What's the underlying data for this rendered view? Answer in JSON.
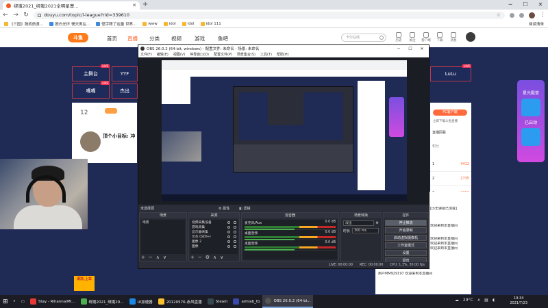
{
  "browser": {
    "tab_title": "绑嵬2021_绑嵬2021全明星寨...",
    "url": "douyu.com/topic/l-league?rid=339610",
    "bookmarks": [
      "《三国》鼓机航食...",
      "脱白光环 慢天男在...",
      "怪宇障了这量 世界...",
      "www",
      "idol",
      "idol",
      "idol 111"
    ],
    "reading_list": "阅读清单"
  },
  "douyu": {
    "logo": "斗鱼",
    "nav": [
      "首页",
      "直播",
      "分类",
      "视频",
      "游戏",
      "鱼吧"
    ],
    "search_placeholder": "卡尔在线",
    "header_icons": [
      "历史",
      "关注",
      "客户端",
      "下载",
      "消息"
    ],
    "live_tiles": [
      "主舞台",
      "YYF",
      "嘴嘴",
      "杰出",
      "LuLu"
    ],
    "live_badge": "LIVE",
    "info_number": "12",
    "streamer_title": "顶个小目标: 冲",
    "pc_client": "PC客户端",
    "pc_sub": "立即下载斗鱼直播",
    "rank_tabs": [
      "直播回看",
      "积分"
    ],
    "ranks": [
      {
        "pos": "1",
        "val": "4412"
      },
      {
        "pos": "2",
        "val": "2735"
      },
      {
        "pos": "3",
        "val": "2050"
      }
    ],
    "chat": [
      "[历史弹幕已加载]",
      "欢迎来到本直播间",
      "欢迎来到本直播间",
      "欢迎来到本直播间",
      "欢迎来到本直播间",
      "用户MM929197 欢迎来到本直播间"
    ],
    "banner_title": "星光殿堂",
    "banner_sub": "已启动",
    "bottom_left": "清凉,上车"
  },
  "obs": {
    "title": "OBS 26.0.2 (64-bit, windows) - 配置文件: 未命名 - 场景: 未命名",
    "menu": [
      "文件(F)",
      "编辑(E)",
      "视图(V)",
      "停靠窗口(D)",
      "配置文件(P)",
      "场景集合(S)",
      "工具(T)",
      "帮助(H)"
    ],
    "source_bar": {
      "label": "未选择源",
      "props": "属性",
      "filters": "滤镜"
    },
    "docks": {
      "scenes": "场景",
      "sources": "来源",
      "mixer": "混音器",
      "transitions": "场景转换",
      "controls": "控件"
    },
    "scene_items": [
      "场景"
    ],
    "source_items": [
      "视频采集设备",
      "游戏采集",
      "显示器采集",
      "文本 (GDI+)",
      "图像 2",
      "图像"
    ],
    "mixer_items": [
      {
        "name": "麦克风/Aux",
        "db": "0.0 dB"
      },
      {
        "name": "桌面音频",
        "db": "0.0 dB"
      },
      {
        "name": "桌面音频",
        "db": "0.0 dB"
      }
    ],
    "transition": {
      "type": "淡出",
      "duration_label": "时长",
      "duration": "300 ms"
    },
    "controls": [
      "停止推流",
      "开始录制",
      "启动虚拟摄像机",
      "工作室模式",
      "设置",
      "退出"
    ],
    "status": [
      "LIVE: 00:00:00",
      "REC: 00:00:00",
      "CPU: 1.3%, 30.00 fps"
    ]
  },
  "taskbar": {
    "items": [
      "Stay - Rihanna/Mi...",
      "绑嵬2021_绑嵬20...",
      "UI加速器",
      "20120576-赤风直播",
      "Steam",
      "aimlab_tb",
      "OBS 26.0.2 (64-bi..."
    ],
    "temp": "29°C",
    "time": "19:34",
    "date": "2021/7/23"
  }
}
